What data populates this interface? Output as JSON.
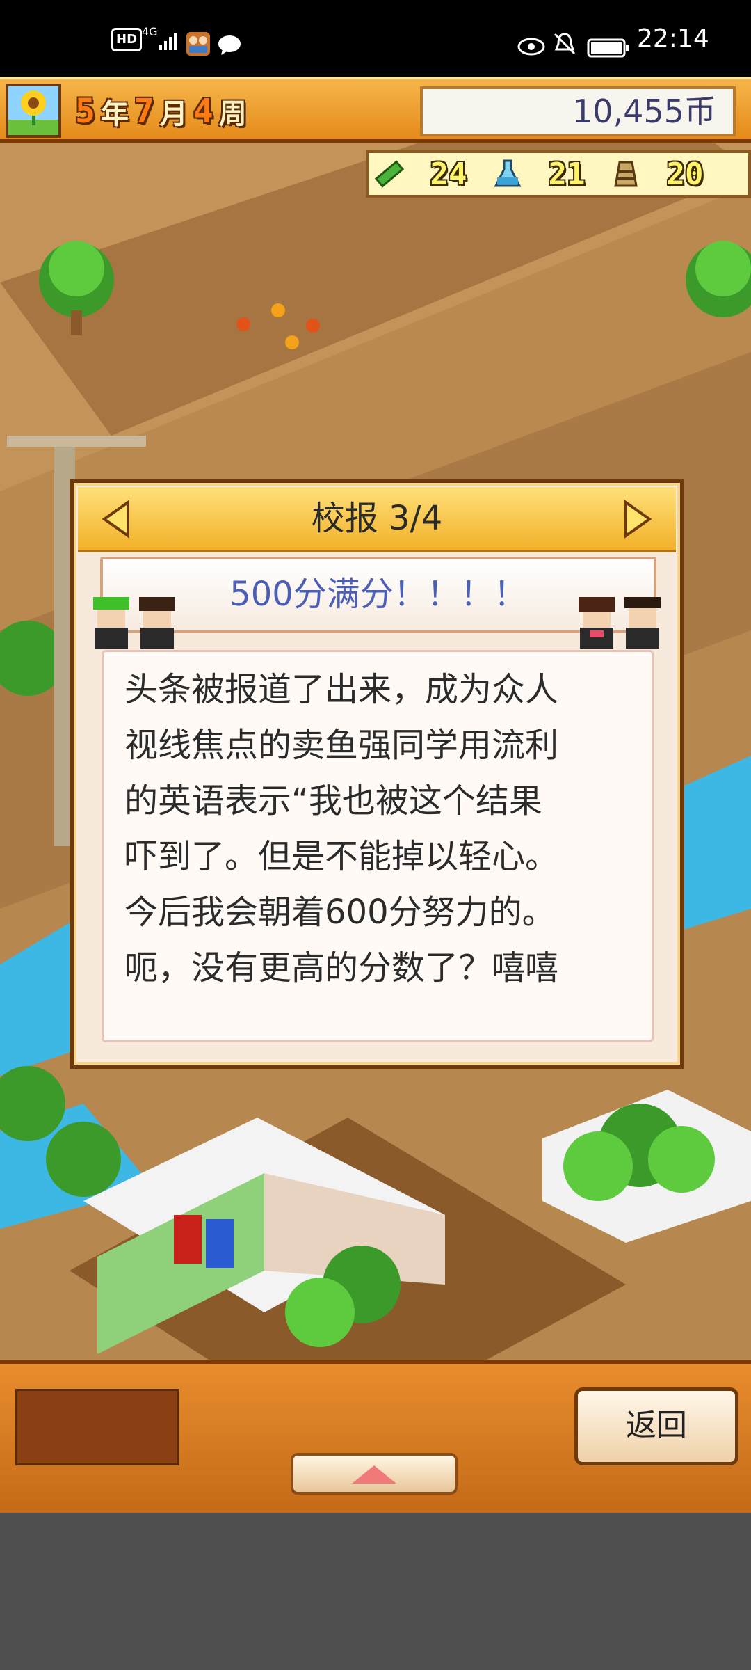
{
  "status_bar": {
    "hd_badge": "HD",
    "network": "4G",
    "time": "22:14",
    "icons": [
      "signal-icon",
      "app-notification-icon",
      "chat-icon",
      "eye-icon",
      "mute-bell-icon",
      "battery-icon"
    ]
  },
  "top_bar": {
    "year_num": "5",
    "year_unit": "年",
    "month_num": "7",
    "month_unit": "月",
    "week_num": "4",
    "week_unit": "周",
    "money": "10,455币",
    "season_icon": "sunflower-icon"
  },
  "resources": [
    {
      "icon": "pencil-icon",
      "value": "24"
    },
    {
      "icon": "flask-icon",
      "value": "21"
    },
    {
      "icon": "weight-icon",
      "value": "20"
    }
  ],
  "dialog": {
    "title": "校报 3/4",
    "headline": "500分满分！！！！",
    "body": "头条被报道了出来，成为众人\n视线焦点的卖鱼强同学用流利\n的英语表示“我也被这个结果\n吓到了。但是不能掉以轻心。\n今后我会朝着600分努力的。\n呃，没有更高的分数了？嘻嘻",
    "prev_icon": "arrow-left-icon",
    "next_icon": "arrow-right-icon"
  },
  "bottom": {
    "back_label": "返回",
    "up_icon": "arrow-up-icon"
  },
  "colors": {
    "topbar": "#f0a436",
    "dialog_header": "#f7c84a",
    "headline": "#4a5fb5",
    "bottom_panel": "#d97b22"
  }
}
